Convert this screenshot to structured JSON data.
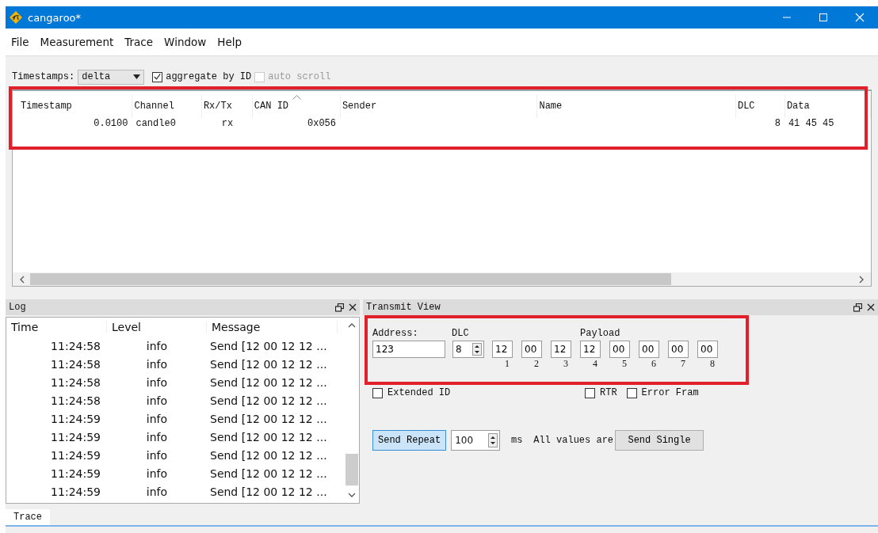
{
  "window": {
    "title": "cangaroo*"
  },
  "menu": [
    "File",
    "Measurement",
    "Trace",
    "Window",
    "Help"
  ],
  "toolbar": {
    "timestamps_label": "Timestamps:",
    "timestamps_value": "delta",
    "aggregate": {
      "label": "aggregate by ID",
      "checked": true,
      "disabled": false
    },
    "auto_scroll": {
      "label": "auto scroll",
      "checked": false,
      "disabled": true
    }
  },
  "trace_table": {
    "columns": [
      {
        "label": "Timestamp",
        "sorted": false
      },
      {
        "label": "Channel",
        "sorted": false
      },
      {
        "label": "Rx/Tx",
        "sorted": false
      },
      {
        "label": "CAN ID",
        "sorted": true
      },
      {
        "label": "Sender",
        "sorted": false
      },
      {
        "label": "Name",
        "sorted": false
      },
      {
        "label": "DLC",
        "sorted": false
      },
      {
        "label": "Data",
        "sorted": false
      }
    ],
    "rows": [
      [
        "0.0100",
        "candle0",
        "rx",
        "0x056",
        "",
        "",
        "8",
        "41 45 45"
      ]
    ]
  },
  "log": {
    "title": "Log",
    "columns": [
      "Time",
      "Level",
      "Message"
    ],
    "rows": [
      [
        "11:24:58",
        "info",
        "Send [12 00 12 12 ..."
      ],
      [
        "11:24:58",
        "info",
        "Send [12 00 12 12 ..."
      ],
      [
        "11:24:58",
        "info",
        "Send [12 00 12 12 ..."
      ],
      [
        "11:24:58",
        "info",
        "Send [12 00 12 12 ..."
      ],
      [
        "11:24:59",
        "info",
        "Send [12 00 12 12 ..."
      ],
      [
        "11:24:59",
        "info",
        "Send [12 00 12 12 ..."
      ],
      [
        "11:24:59",
        "info",
        "Send [12 00 12 12 ..."
      ],
      [
        "11:24:59",
        "info",
        "Send [12 00 12 12 ..."
      ],
      [
        "11:24:59",
        "info",
        "Send [12 00 12 12 ..."
      ]
    ]
  },
  "transmit": {
    "title": "Transmit View",
    "address_label": "Address:",
    "address": "123",
    "dlc_label": "DLC",
    "dlc": "8",
    "payload_label": "Payload",
    "payload": [
      {
        "value": "12",
        "index": "1"
      },
      {
        "value": "00",
        "index": "2"
      },
      {
        "value": "12",
        "index": "3"
      },
      {
        "value": "12",
        "index": "4"
      },
      {
        "value": "00",
        "index": "5"
      },
      {
        "value": "00",
        "index": "6"
      },
      {
        "value": "00",
        "index": "7"
      },
      {
        "value": "00",
        "index": "8"
      }
    ],
    "extended_id": {
      "label": "Extended ID",
      "checked": false
    },
    "rtr": {
      "label": "RTR",
      "checked": false
    },
    "error_frame": {
      "label": "Error Fram",
      "checked": false
    },
    "send_repeat": {
      "label": "Send Repeat",
      "pressed": true
    },
    "interval": "100",
    "interval_unit": "ms",
    "note": "All values are",
    "send_single": "Send Single"
  },
  "bottom_tabs": [
    {
      "label": "Trace",
      "selected": true
    }
  ]
}
